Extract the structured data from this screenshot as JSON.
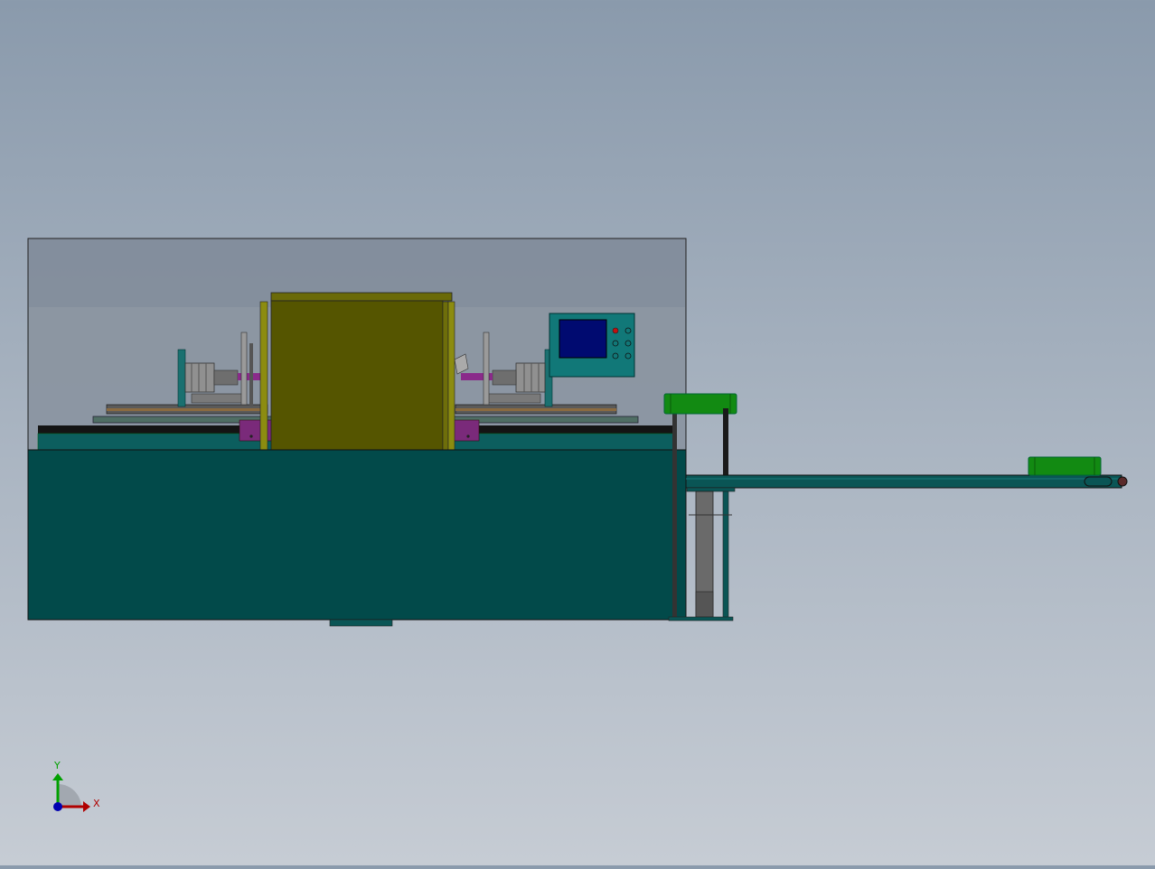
{
  "triad": {
    "x_label": "X",
    "y_label": "Y",
    "x_color": "#b00000",
    "y_color": "#00a000",
    "z_color": "#0000b0"
  },
  "colors": {
    "enclosure_glass": "#7a8594",
    "base_cabinet": "#024a4a",
    "base_top_rail": "#0b5a5a",
    "olive_cover": "#555500",
    "olive_frame": "#8c8c10",
    "control_box": "#117878",
    "screen": "#000a70",
    "motor_gray": "#8e8e8e",
    "purple_block": "#7a2a7a",
    "green_tube": "#128a12",
    "conveyor": "#0a5555",
    "column_gray": "#6a6a6a"
  }
}
